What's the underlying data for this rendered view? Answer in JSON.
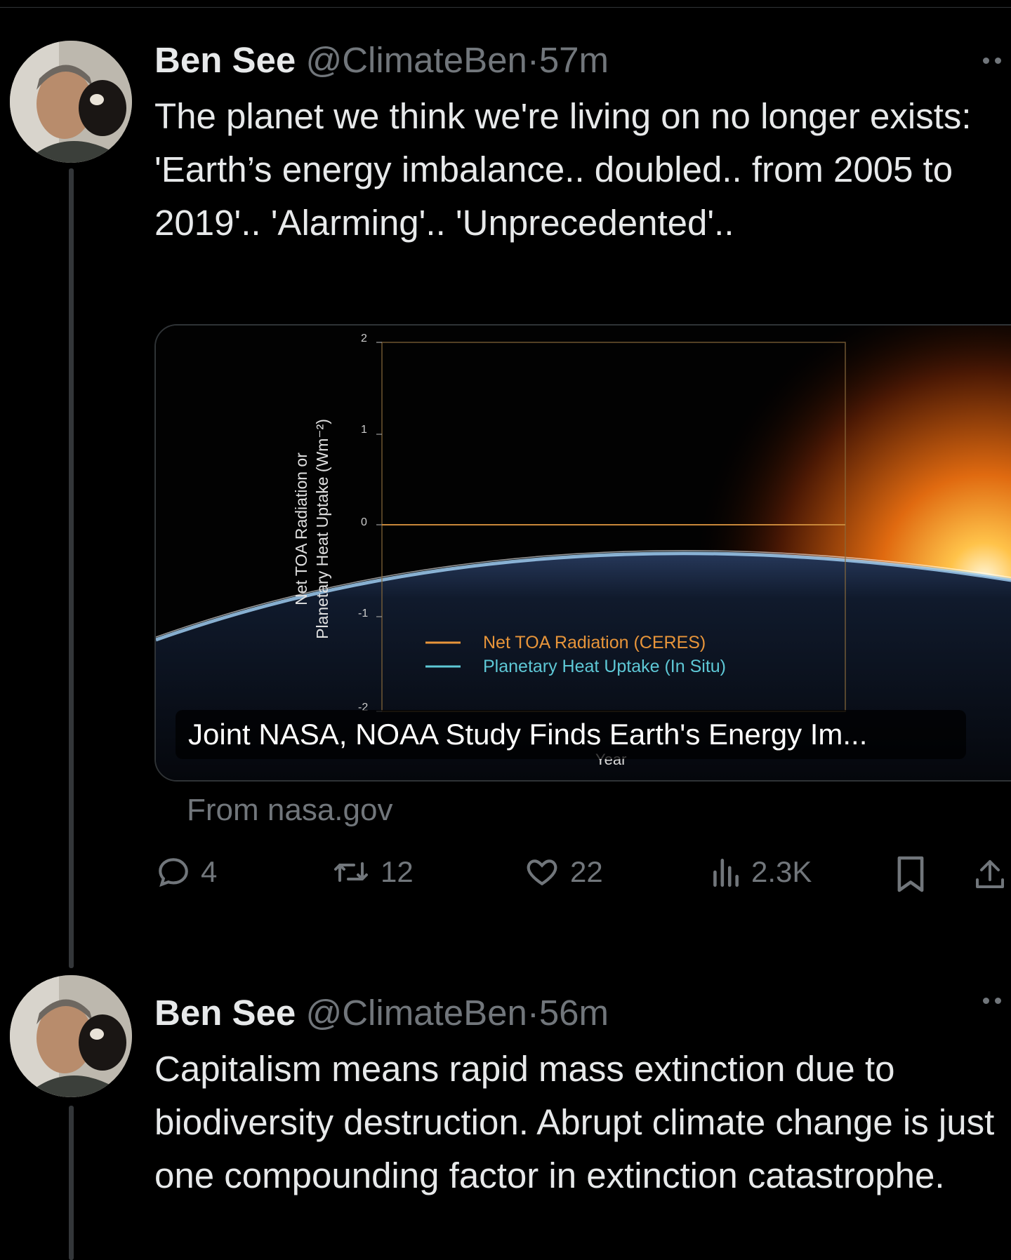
{
  "tweets": [
    {
      "author_name": "Ben See",
      "handle": "@ClimateBen",
      "separator": "·",
      "time": "57m",
      "text": "The planet we think we're living on no longer exists:\n'Earth’s energy imbalance.. doubled.. from 2005 to 2019'.. 'Alarming'.. 'Unprecedented'..",
      "card": {
        "title": "Joint NASA, NOAA Study Finds Earth's Energy Im...",
        "source": "From nasa.gov",
        "chart": {
          "y_label_line1": "Net TOA Radiation or",
          "y_label_line2": "Planetary Heat Uptake (Wm⁻²)",
          "x_label": "Year",
          "y_ticks": [
            "2",
            "1",
            "0",
            "-1",
            "-2"
          ],
          "legend": [
            "Net TOA Radiation (CERES)",
            "Planetary Heat Uptake (In Situ)"
          ],
          "colors": {
            "ceres": "#e8953a",
            "insitu": "#5ec8d6"
          }
        }
      },
      "actions": {
        "replies": "4",
        "reposts": "12",
        "likes": "22",
        "views": "2.3K"
      }
    },
    {
      "author_name": "Ben See",
      "handle": "@ClimateBen",
      "separator": "·",
      "time": "56m",
      "text": "Capitalism means rapid mass extinction due to biodiversity destruction. Abrupt climate change is just one compounding factor in extinction catastrophe."
    }
  ],
  "colors": {
    "background": "#000000",
    "text": "#e7e9ea",
    "muted": "#71767b",
    "border": "#2f3336"
  }
}
